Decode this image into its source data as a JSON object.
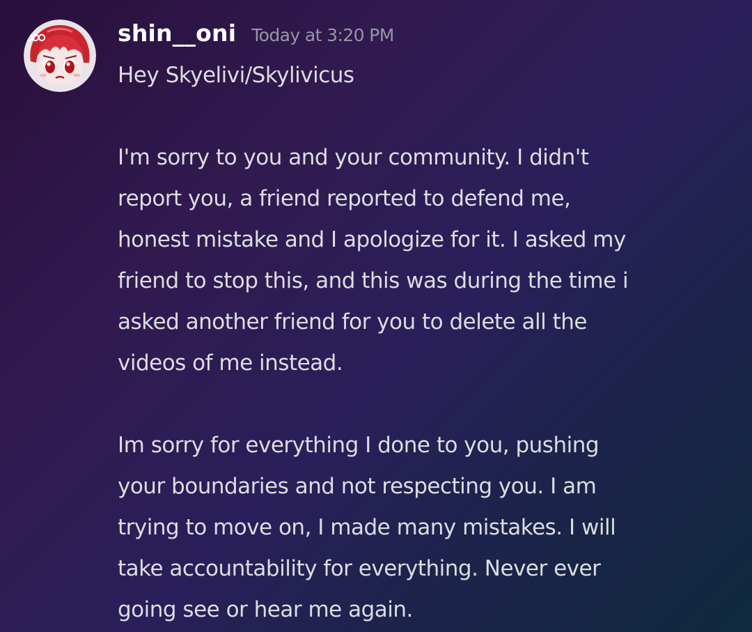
{
  "message": {
    "author": "shin__oni",
    "timestamp": "Today at 3:20 PM",
    "avatar_icon": "chibi-avatar-red-hair",
    "paragraphs": [
      [
        "Hey Skyelivi/Skylivicus"
      ],
      [
        "I'm sorry to you and your community. I didn't",
        "report you, a friend reported to defend me,",
        "honest mistake and I apologize for it. I asked my",
        "friend to stop this, and this was during the time i",
        "asked another friend for you to delete all the",
        "videos of me instead."
      ],
      [
        "Im sorry for everything I done to you, pushing",
        "your boundaries and not respecting you. I am",
        "trying to move on, I made many mistakes. I will",
        "take accountability for everything. Never ever",
        "going see or hear me again."
      ]
    ]
  },
  "colors": {
    "username": "#ffffff",
    "timestamp": "#9498a3",
    "text": "#dcdde1"
  }
}
